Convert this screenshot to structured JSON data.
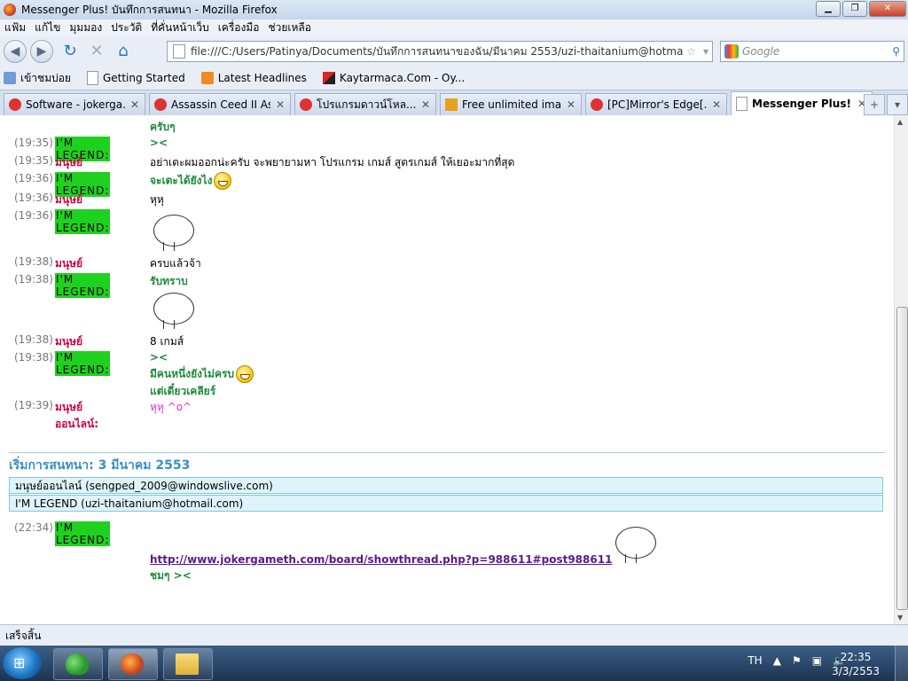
{
  "window": {
    "title": "Messenger Plus! บันทึกการสนทนา - Mozilla Firefox",
    "btn_min": "▁",
    "btn_max": "❐",
    "btn_close": "✕"
  },
  "menu": [
    "แฟ้ม",
    "แก้ไข",
    "มุมมอง",
    "ประวัติ",
    "ที่คั่นหน้าเว็บ",
    "เครื่องมือ",
    "ช่วยเหลือ"
  ],
  "nav": {
    "url": "file:///C:/Users/Patinya/Documents/บันทึกการสนทนาของฉัน/มีนาคม 2553/uzi-thaitanium@hotmail.com.",
    "search_placeholder": "Google"
  },
  "bookmarks": [
    "เข้าชมบ่อย",
    "Getting Started",
    "Latest Headlines",
    "Kaytarmaca.Com - Oy..."
  ],
  "tabs": [
    {
      "label": "Software - jokerga...",
      "active": false
    },
    {
      "label": "Assassin Ceed II As...",
      "active": false
    },
    {
      "label": "โปรแกรมดาวน์โหล...",
      "active": false
    },
    {
      "label": "Free unlimited ima...",
      "active": false
    },
    {
      "label": "[PC]Mirror's Edge[...",
      "active": false
    },
    {
      "label": "Messenger Plus! ...",
      "active": true
    }
  ],
  "chat": {
    "legend_nick": "I'M LEGEND",
    "other_nick": "มนุษย์ออนไลน์",
    "colon": ":",
    "messages": [
      {
        "time": "(19:35)",
        "who": "legend",
        "text": "><"
      },
      {
        "time": "(19:35)",
        "who": "other",
        "text": "อย่าเตะผมออกน่ะครับ จะพยายามหา โปรแกรม เกมส์ สูตรเกมส์ ให้เยอะมากที่สุด"
      },
      {
        "time": "(19:36)",
        "who": "legend",
        "text": "จะเตะได้ยังไง"
      },
      {
        "time": "(19:36)",
        "who": "other",
        "text": "หุหุ"
      },
      {
        "time": "(19:36)",
        "who": "legend",
        "text": ""
      },
      {
        "time": "(19:38)",
        "who": "other",
        "text": "ครบแล้วจ้า"
      },
      {
        "time": "(19:38)",
        "who": "legend",
        "text": "รับทราบ"
      },
      {
        "time": "(19:38)",
        "who": "other",
        "text": "8 เกมส์"
      },
      {
        "time": "(19:38)",
        "who": "legend",
        "text": "><"
      },
      {
        "time": "(19:39)",
        "who": "other",
        "text": "หุหุ ^o^"
      }
    ],
    "top_partial": "ครับๆ",
    "msg_extra1": "มีคนหนึ่งยังไม่ครบ",
    "msg_extra2": "แต่เดี๋ยวเคลียร์"
  },
  "session": {
    "heading": "เริ่มการสนทนา: 3 มีนาคม 2553",
    "participant1": "มนุษย์ออนไลน์ (sengped_2009@windowslive.com)",
    "participant2": "I'M LEGEND (uzi-thaitanium@hotmail.com)",
    "time": "(22:34)",
    "link": "http://www.jokergameth.com/board/showthread.php?p=988611#post988611",
    "followup": "ชมๆ ><"
  },
  "status": "เสร็จสิ้น",
  "taskbar": {
    "lang": "TH",
    "time": "22:35",
    "date": "3/3/2553"
  }
}
